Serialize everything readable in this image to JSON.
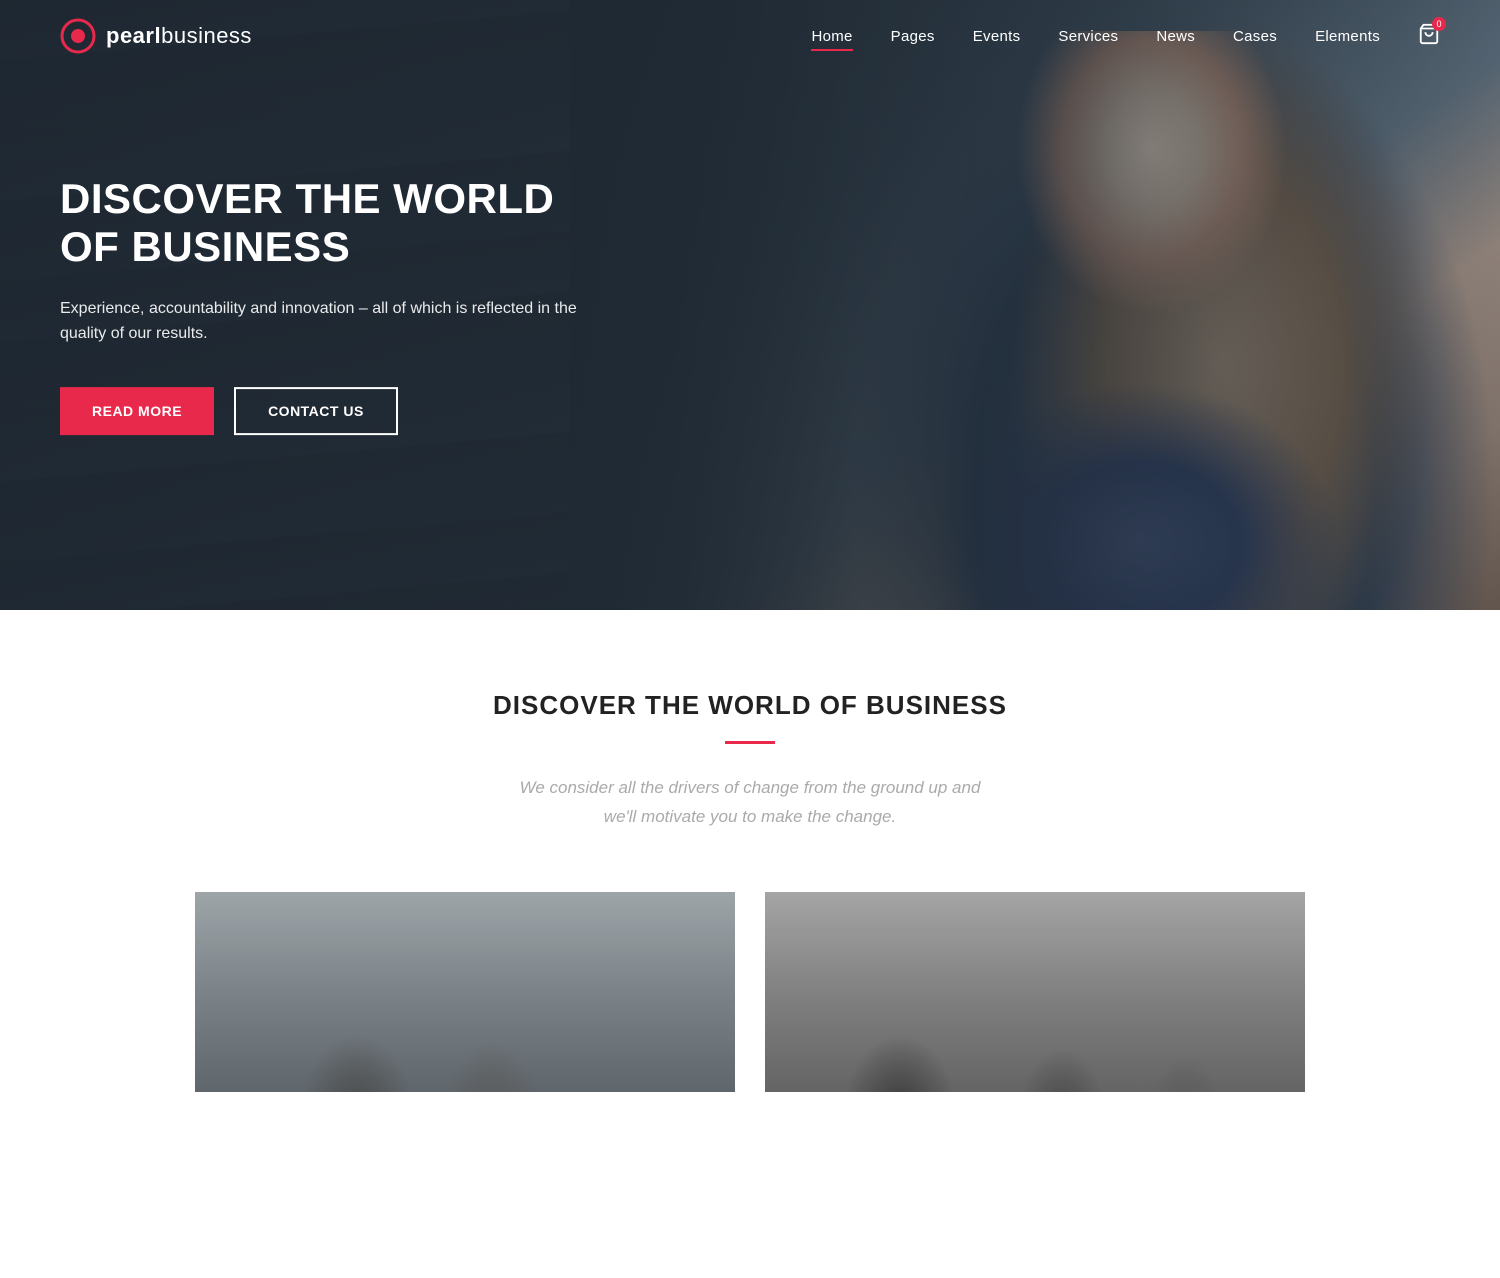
{
  "brand": {
    "name_bold": "pearl",
    "name_light": "business"
  },
  "nav": {
    "items": [
      {
        "label": "Home",
        "active": true
      },
      {
        "label": "Pages",
        "active": false
      },
      {
        "label": "Events",
        "active": false
      },
      {
        "label": "Services",
        "active": false
      },
      {
        "label": "News",
        "active": false
      },
      {
        "label": "Cases",
        "active": false
      },
      {
        "label": "Elements",
        "active": false
      }
    ],
    "cart_badge": "0"
  },
  "hero": {
    "title_line1": "DISCOVER THE WORLD",
    "title_line2": "OF BUSINESS",
    "subtitle": "Experience, accountability and innovation – all of which is reflected in the quality of our results.",
    "btn_primary": "Read More",
    "btn_outline": "Contact Us"
  },
  "section": {
    "heading": "DISCOVER THE WORLD OF BUSINESS",
    "description": "We consider all the drivers of change from the ground up and we'll motivate you to make the change."
  },
  "colors": {
    "accent": "#e8294c",
    "dark": "#222222",
    "gray_text": "#aaaaaa"
  }
}
